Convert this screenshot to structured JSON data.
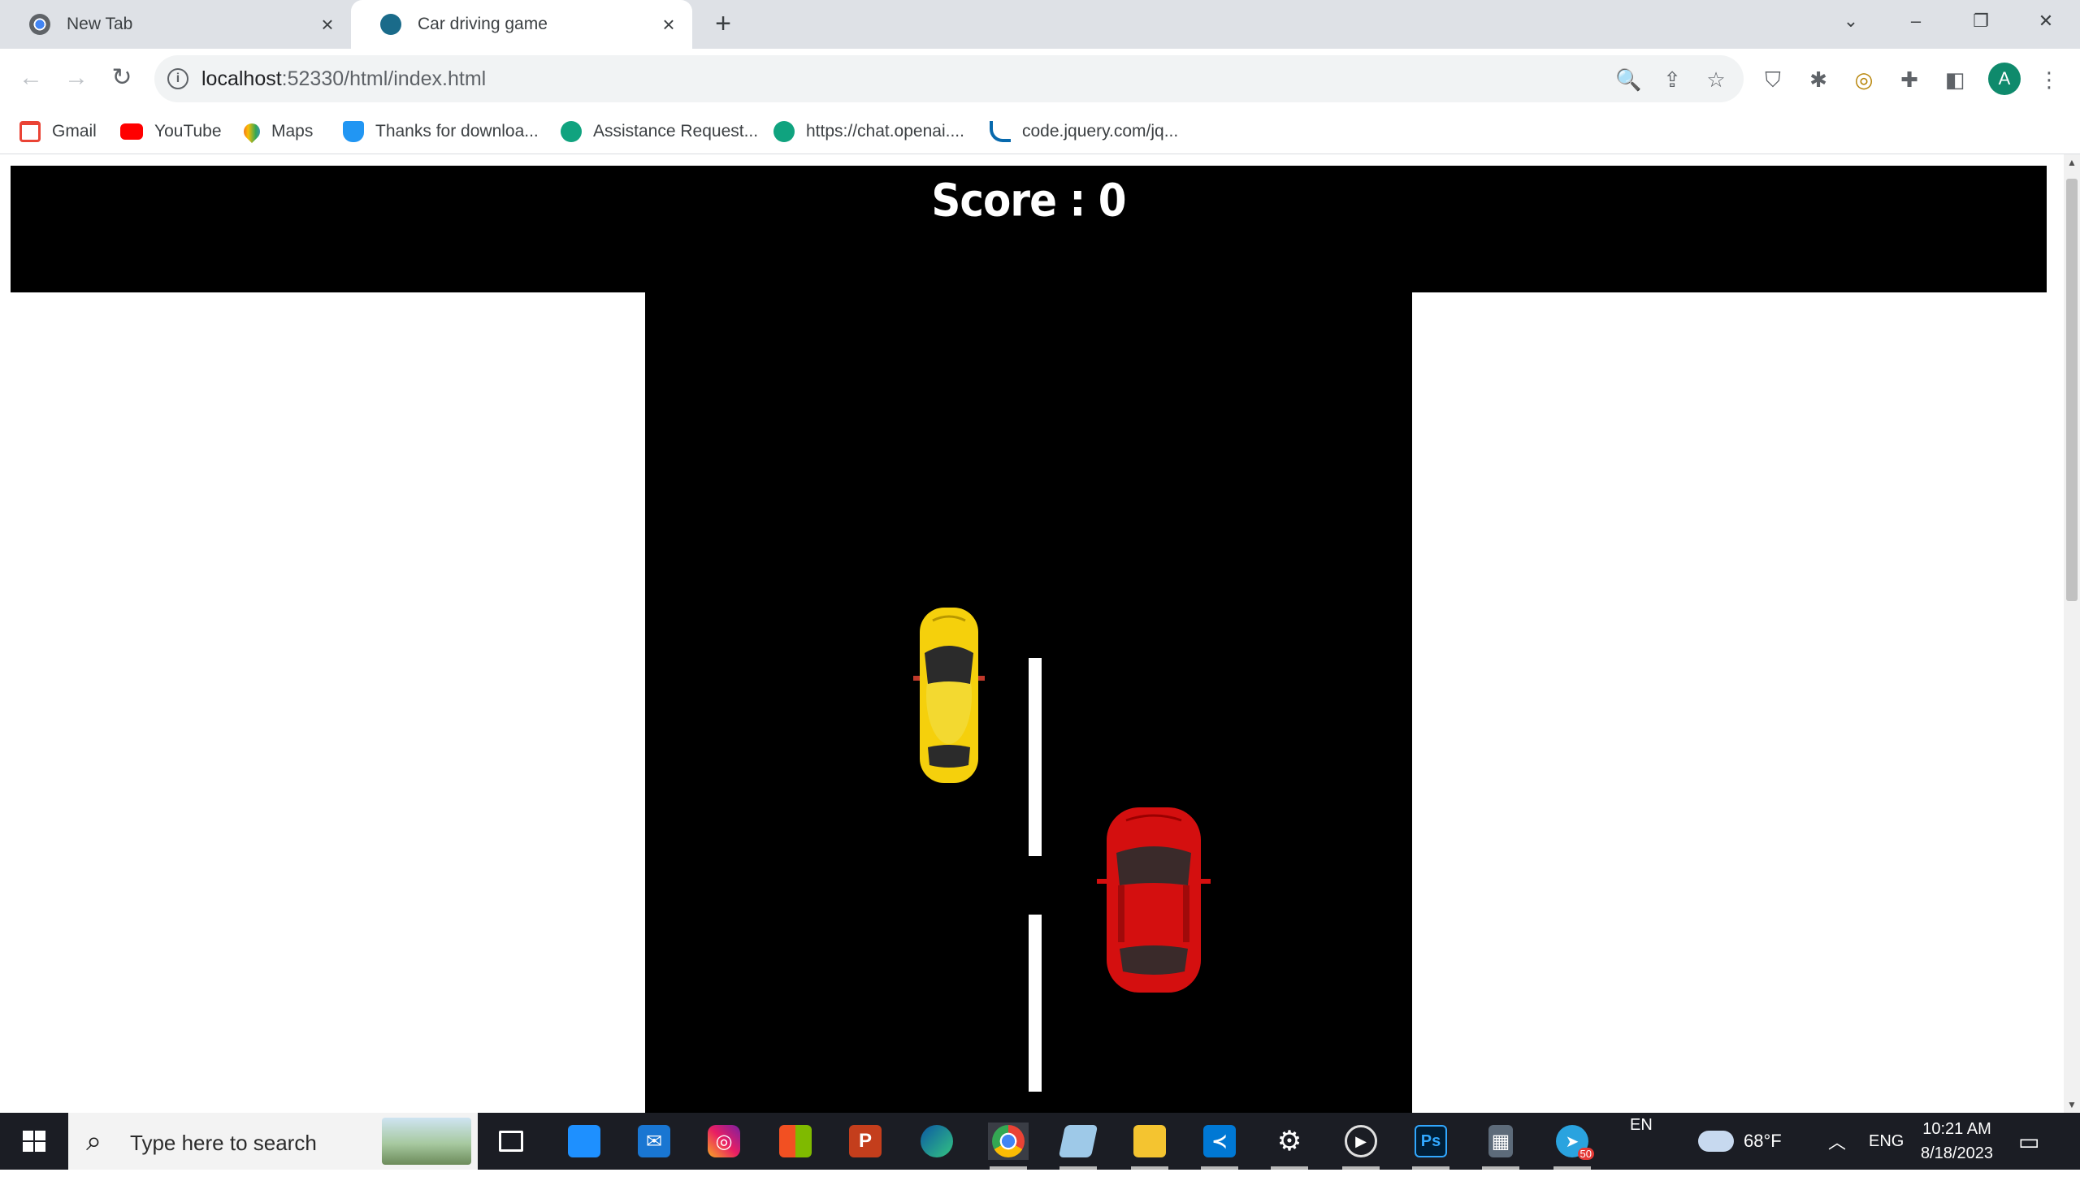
{
  "browser": {
    "tabs": [
      {
        "title": "New Tab",
        "close": "×"
      },
      {
        "title": "Car driving game",
        "close": "×"
      }
    ],
    "new_tab": "+",
    "window": {
      "minimize": "–",
      "maximize": "❐",
      "close": "✕",
      "tab_search": "⌄"
    },
    "nav": {
      "back": "←",
      "forward": "→",
      "reload": "↻"
    },
    "address": {
      "host": "localhost",
      "rest": ":52330/html/index.html",
      "info": "i"
    },
    "omnibox_icons": {
      "zoom": "🔍",
      "share": "⇪",
      "star": "☆"
    },
    "extensions": {
      "shield": "⛉",
      "bug": "✱",
      "swirl": "◎",
      "puzzle": "✚",
      "sidepanel": "◧",
      "menu": "⋮"
    },
    "avatar": "A",
    "bookmarks": [
      {
        "label": "Gmail",
        "color": "#ea4335"
      },
      {
        "label": "YouTube",
        "color": "#ff0000"
      },
      {
        "label": "Maps",
        "color": "#34a853"
      },
      {
        "label": "Thanks for downloa...",
        "color": "#2196f3"
      },
      {
        "label": "Assistance Request...",
        "color": "#10a37f"
      },
      {
        "label": "https://chat.openai....",
        "color": "#10a37f"
      },
      {
        "label": "code.jquery.com/jq...",
        "color": "#0769ad"
      }
    ]
  },
  "game": {
    "score_label": "Score : 0",
    "road_color": "#000000",
    "player_car_color": "#d40f0f",
    "enemy_car_color": "#f5d00c"
  },
  "taskbar": {
    "search_placeholder": "Type here to search",
    "lang": "EN",
    "weather": "68°F",
    "input": "ENG",
    "time": "10:21 AM",
    "date": "8/18/2023",
    "telegram_badge": "50"
  }
}
